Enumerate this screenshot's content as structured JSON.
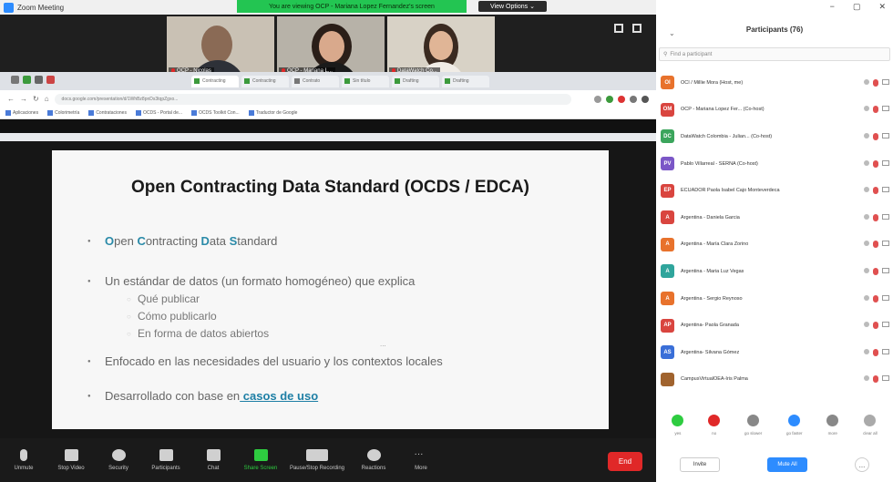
{
  "window": {
    "title": "Zoom Meeting",
    "share_banner": "You are viewing OCP - Mariana Lopez Fernandez's screen",
    "view_options": "View Options ⌄"
  },
  "thumbnails": [
    {
      "name": "OCP - Nicolas"
    },
    {
      "name": "OCP - Mariana L..."
    },
    {
      "name": "DataWatch Co..."
    }
  ],
  "browser": {
    "tabs": [
      "Contracting",
      "Contracting",
      "Contrato",
      "Sin título",
      "Drafting",
      "Drafting"
    ],
    "url": "docs.google.com/presentation/d/1WhBz8pnDs3tqpZgxo...",
    "bookmarks": [
      "Aplicaciones",
      "Colorimetría",
      "Contrataciones",
      "OCDS - Portal de...",
      "OCDS Toolkit Con...",
      "Traductor de Google"
    ]
  },
  "slide": {
    "title": "Open Contracting Data Standard (OCDS / EDCA)",
    "b1_p1": "O",
    "b1_p2": "pen ",
    "b1_p3": "C",
    "b1_p4": "ontracting ",
    "b1_p5": "D",
    "b1_p6": "ata ",
    "b1_p7": "S",
    "b1_p8": "tandard",
    "b2": "Un estándar de datos (un formato homogéneo) que explica",
    "b2_sub": [
      "Qué publicar",
      "Cómo publicarlo",
      "En forma de datos abiertos"
    ],
    "b3": "Enfocado en las necesidades del usuario y los contextos locales",
    "b4_prefix": "Desarrollado con base en",
    "b4_link": " casos de uso",
    "dots": "..."
  },
  "toolbar": {
    "unmute": "Unmute",
    "stop_video": "Stop Video",
    "security": "Security",
    "participants": "Participants",
    "participants_count": "76",
    "chat": "Chat",
    "share_screen": "Share Screen",
    "recording": "Pause/Stop Recording",
    "reactions": "Reactions",
    "more": "More",
    "end": "End"
  },
  "panel": {
    "minimize": "−",
    "maximize": "▢",
    "close": "✕",
    "chevron": "⌄",
    "title": "Participants (76)",
    "search_placeholder": "Find a participant",
    "participants": [
      {
        "initials": "OI",
        "color": "#e8722c",
        "name": "OCI / Millie Mora (Host, me)"
      },
      {
        "initials": "OM",
        "color": "#d9453f",
        "name": "OCP - Mariana Lopez Fer... (Co-host)"
      },
      {
        "initials": "DC",
        "color": "#3ba55c",
        "name": "DataWatch Colombia - Julian... (Co-host)"
      },
      {
        "initials": "PV",
        "color": "#7b57c7",
        "name": "Pablo Villarreal - SERNA (Co-host)"
      },
      {
        "initials": "EP",
        "color": "#d9453f",
        "name": "ECUADOR Paola Isabel Cajo Monteverdeca"
      },
      {
        "initials": "A",
        "color": "#d9453f",
        "name": "Argentina - Daniela Garcia"
      },
      {
        "initials": "A",
        "color": "#e8722c",
        "name": "Argentina - María Clara Zorino"
      },
      {
        "initials": "A",
        "color": "#2fa59c",
        "name": "Argentina - Maria Luz Vegas"
      },
      {
        "initials": "A",
        "color": "#e8722c",
        "name": "Argentina - Sergio Reynoso"
      },
      {
        "initials": "AP",
        "color": "#d9453f",
        "name": "Argentina- Paola Granada"
      },
      {
        "initials": "AS",
        "color": "#3a6fd8",
        "name": "Argentina- Silvana Gómez"
      },
      {
        "initials": "",
        "color": "#a0632e",
        "name": "CampusVirtualOEA-Iris Palma"
      }
    ],
    "reactions": [
      {
        "label": "yes",
        "color": "#2ecc40"
      },
      {
        "label": "no",
        "color": "#e02828"
      },
      {
        "label": "go slower",
        "color": "#888"
      },
      {
        "label": "go faster",
        "color": "#2d8cff"
      },
      {
        "label": "more",
        "color": "#888"
      },
      {
        "label": "clear all",
        "color": "#aaa"
      }
    ],
    "invite": "Invite",
    "mute_all": "Mute All",
    "more": "..."
  }
}
